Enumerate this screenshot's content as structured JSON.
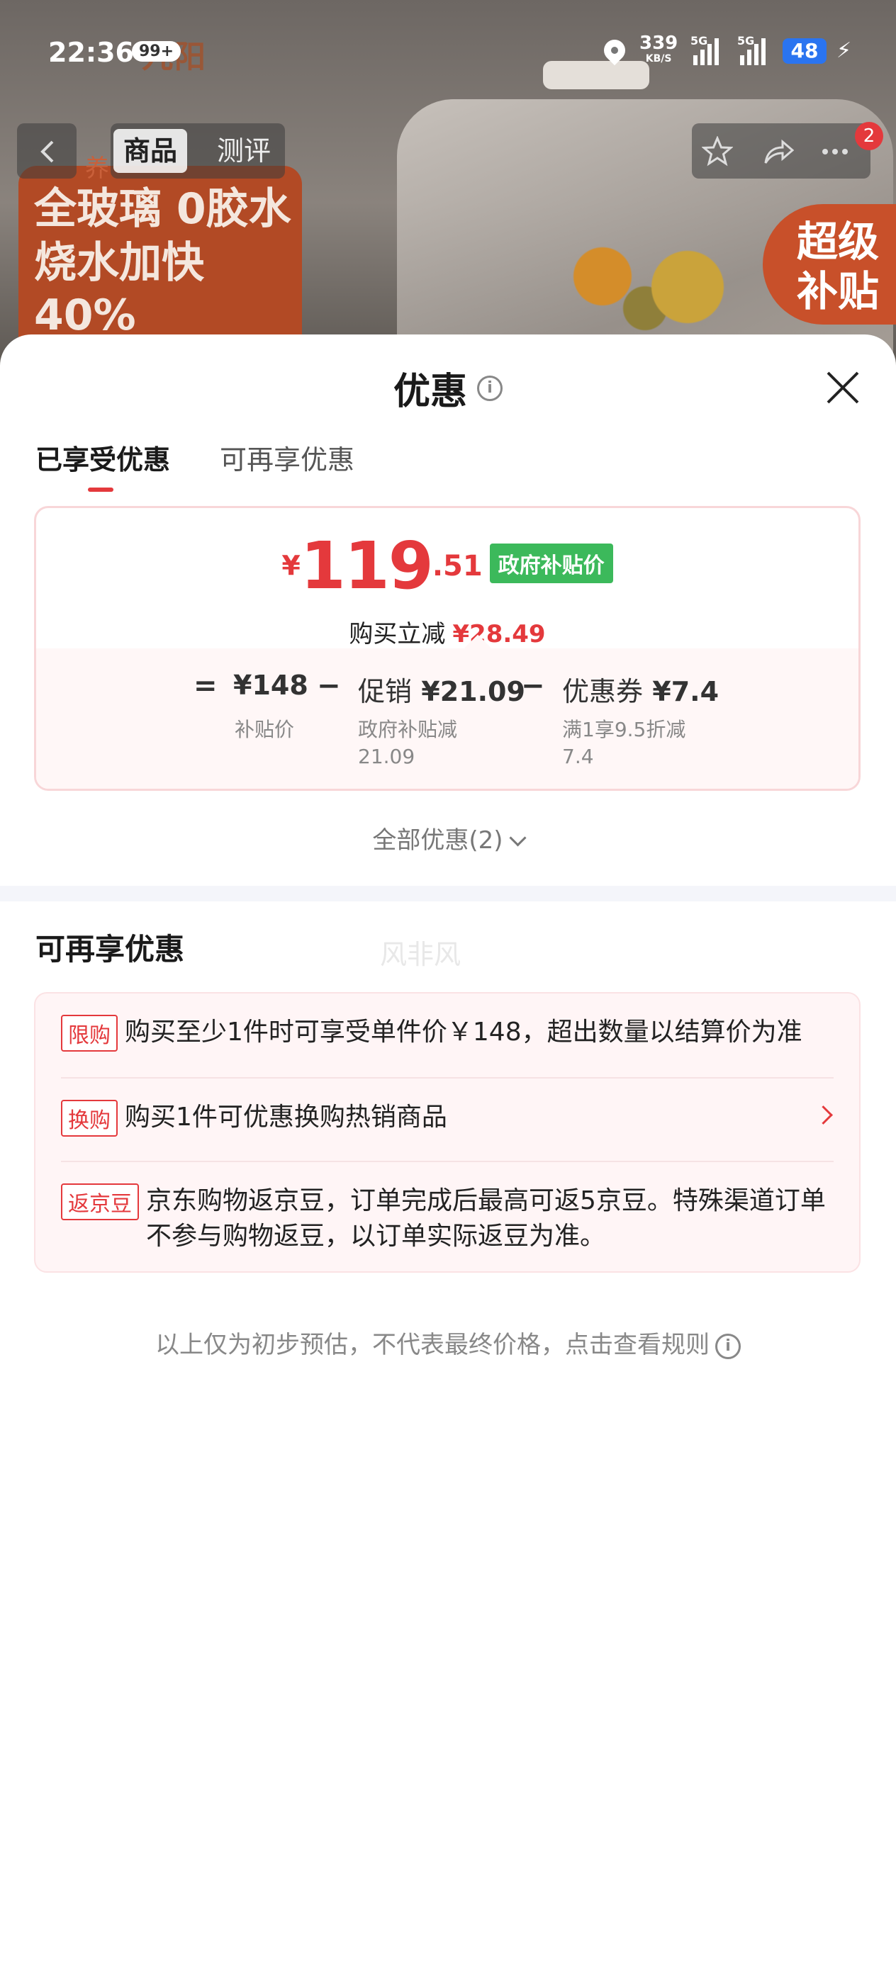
{
  "status_bar": {
    "time": "22:36",
    "notif_count": "99+",
    "net_speed": "339",
    "net_unit": "KB/S",
    "sig1_label": "5G",
    "sig2_label": "5G",
    "battery": "48"
  },
  "background": {
    "brand": "九阳",
    "promo_tag": "养",
    "promo_line1": "全玻璃 0胶水",
    "promo_line2": "烧水加快40%",
    "super_line1": "超级",
    "super_line2": "补贴"
  },
  "nav": {
    "tab_product": "商品",
    "tab_review": "测评",
    "more_badge": "2"
  },
  "sheet": {
    "title": "优惠",
    "tabs": [
      "已享受优惠",
      "可再享优惠"
    ],
    "price": {
      "currency": "¥",
      "integer": "119",
      "decimal": ".51",
      "tag": "政府补贴价",
      "save_label": "购买立减",
      "save_amount": "¥28.49"
    },
    "breakdown": {
      "eq": "=",
      "minus": "−",
      "base_value": "¥148",
      "base_sub": "补贴价",
      "promo_label": "促销",
      "promo_value": "¥21.09",
      "promo_sub": "政府补贴减21.09",
      "coupon_label": "优惠券",
      "coupon_value": "¥7.4",
      "coupon_sub": "满1享9.5折减7.4"
    },
    "all_discounts": "全部优惠(2)",
    "section_title": "可再享优惠",
    "watermark": "风非风",
    "offers": [
      {
        "badge": "限购",
        "text": "购买至少1件时可享受单件价￥148，超出数量以结算价为准"
      },
      {
        "badge": "换购",
        "text": "购买1件可优惠换购热销商品"
      },
      {
        "badge": "返京豆",
        "text": "京东购物返京豆，订单完成后最高可返5京豆。特殊渠道订单不参与购物返豆，以订单实际返豆为准。"
      }
    ],
    "footnote": "以上仅为初步预估，不代表最终价格，点击查看规则"
  },
  "colors": {
    "accent": "#e4393c",
    "tag_green": "#3cb95b",
    "card_border": "#f8d6d8",
    "offer_bg": "#fff5f6"
  }
}
